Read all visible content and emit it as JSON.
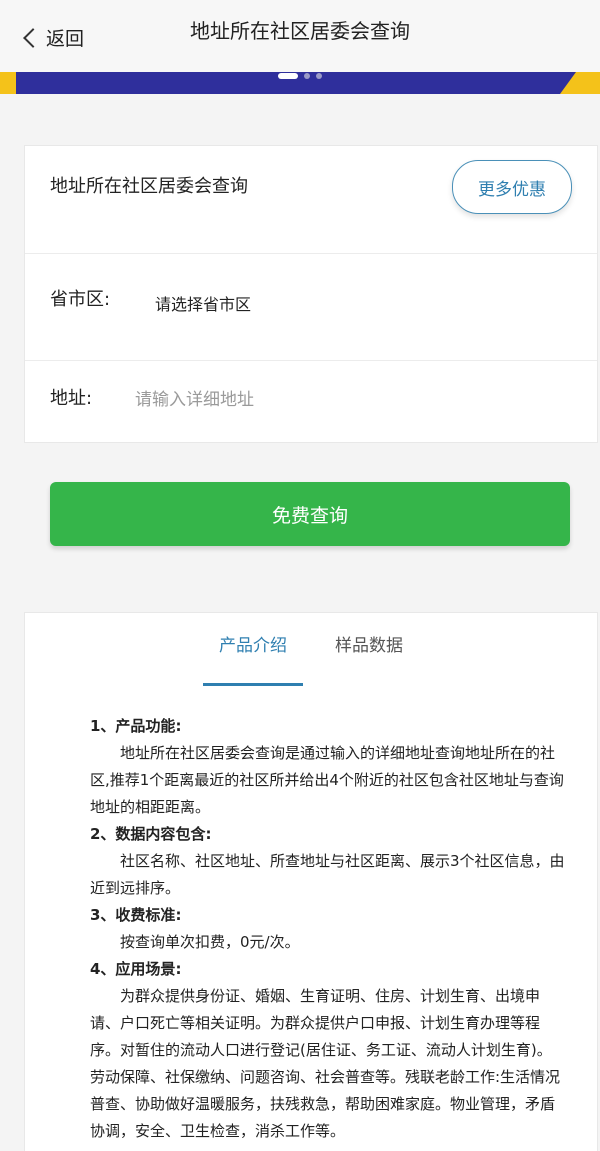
{
  "header": {
    "back_label": "返回",
    "title": "地址所在社区居委会查询"
  },
  "colors": {
    "accent": "#2f7fb0",
    "button_green": "#35b54a",
    "banner": "#2f2f9c",
    "banner_accent": "#f4c21a"
  },
  "form": {
    "product_name": "地址所在社区居委会查询",
    "more_label": "更多优惠",
    "region_label": "省市区:",
    "region_value": "请选择省市区",
    "address_label": "地址:",
    "address_placeholder": "请输入详细地址",
    "address_value": ""
  },
  "submit_label": "免费查询",
  "tabs": [
    {
      "label": "产品介绍",
      "active": true
    },
    {
      "label": "样品数据",
      "active": false
    }
  ],
  "intro": {
    "s1_title": "1、产品功能:",
    "s1_text": "地址所在社区居委会查询是通过输入的详细地址查询地址所在的社区,推荐1个距离最近的社区所并给出4个附近的社区包含社区地址与查询地址的相距距离。",
    "s2_title": "2、数据内容包含:",
    "s2_text": "社区名称、社区地址、所查地址与社区距离、展示3个社区信息，由近到远排序。",
    "s3_title": "3、收费标准:",
    "s3_text": "按查询单次扣费，0元/次。",
    "s4_title": "4、应用场景:",
    "s4_text": "为群众提供身份证、婚姻、生育证明、住房、计划生育、出境申请、户口死亡等相关证明。为群众提供户口申报、计划生育办理等程序。对暂住的流动人口进行登记(居住证、务工证、流动人计划生育)。劳动保障、社保缴纳、问题咨询、社会普查等。残联老龄工作:生活情况普查、协助做好温暖服务，扶残救急，帮助困难家庭。物业管理，矛盾协调，安全、卫生检查，消杀工作等。"
  }
}
